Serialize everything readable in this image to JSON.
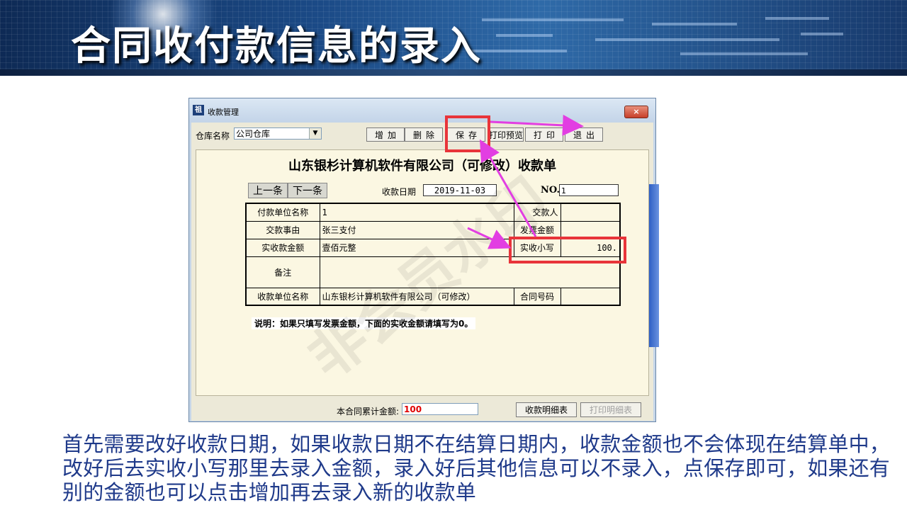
{
  "slide": {
    "title": "合同收付款信息的录入",
    "description": "首先需要改好收款日期，如果收款日期不在结算日期内，收款金额也不会体现在结算单中，改好后去实收小写那里去录入金额，录入好后其他信息可以不录入，点保存即可，如果还有别的金额也可以点击增加再去录入新的收款单"
  },
  "window": {
    "title": "收款管理",
    "close_label": "×",
    "app_icon": "祖"
  },
  "toolbar": {
    "warehouse_label": "仓库名称",
    "warehouse_value": "公司仓库",
    "buttons": [
      "增加",
      "删除",
      "保存",
      "打印预览",
      "打印",
      "退出"
    ]
  },
  "form": {
    "title": "山东银杉计算机软件有限公司（可修改）收款单",
    "prev_label": "上一条",
    "next_label": "下一条",
    "date_label": "收款日期",
    "date_value": "2019-11-03",
    "no_label": "NO.",
    "no_value": "1",
    "rows": {
      "payer_label": "付款单位名称",
      "payer_value": "1",
      "handover_label": "交款人",
      "reason_label": "交款事由",
      "reason_value": "张三支付",
      "invoice_label": "发票金额",
      "amount_label": "实收款金额",
      "amount_value": "壹佰元整",
      "amount_small_label": "实收小写",
      "amount_small_value": "100.",
      "remark_label": "备注",
      "receiver_label": "收款单位名称",
      "receiver_value": "山东银杉计算机软件有限公司（可修改）",
      "contract_label": "合同号码"
    },
    "note": "说明：如果只填写发票金额，下面的实收金额请填写为0。"
  },
  "footer": {
    "sum_label": "本合同累计金额:",
    "sum_value": "100",
    "detail_button": "收款明细表",
    "print_detail_button": "打印明细表"
  },
  "watermark": "非会员水印",
  "colors": {
    "highlight": "#e8343a",
    "arrow": "#e23ee2",
    "description_text": "#1f3a8a"
  }
}
